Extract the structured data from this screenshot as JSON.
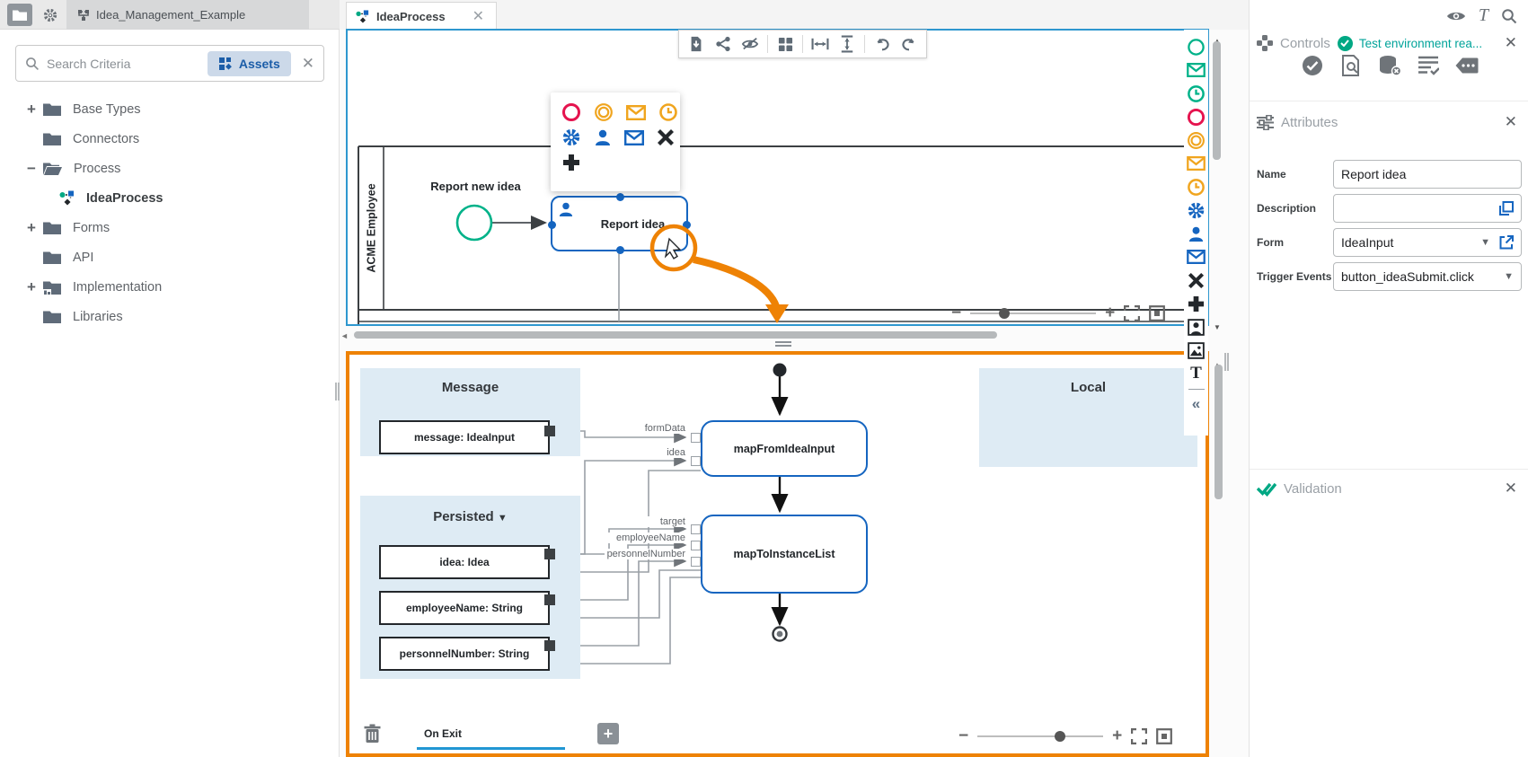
{
  "header": {
    "project_tab_label": "Idea_Management_Example"
  },
  "sidebar": {
    "search_placeholder": "Search Criteria",
    "assets_label": "Assets",
    "tree": [
      {
        "expander": "+",
        "label": "Base Types"
      },
      {
        "expander": "",
        "label": "Connectors"
      },
      {
        "expander": "−",
        "label": "Process"
      },
      {
        "expander": "",
        "label": "IdeaProcess"
      },
      {
        "expander": "+",
        "label": "Forms"
      },
      {
        "expander": "",
        "label": "API"
      },
      {
        "expander": "+",
        "label": "Implementation"
      },
      {
        "expander": "",
        "label": "Libraries"
      }
    ]
  },
  "editor": {
    "tab_label": "IdeaProcess",
    "bpmn": {
      "lane_label": "ACME Employee",
      "start_event_label": "Report new idea",
      "task_label": "Report idea"
    },
    "mapping": {
      "message_section": "Message",
      "persisted_section": "Persisted",
      "local_section": "Local",
      "message_box": "message: IdeaInput",
      "persisted_box_1": "idea: Idea",
      "persisted_box_2": "employeeName: String",
      "persisted_box_3": "personnelNumber: String",
      "node_1": "mapFromIdeaInput",
      "node_2": "mapToInstanceList",
      "label_formData": "formData",
      "label_idea": "idea",
      "label_target": "target",
      "label_employeeName": "employeeName",
      "label_personnelNumber": "personnelNumber",
      "footer_tab": "On Exit"
    }
  },
  "panel": {
    "controls": {
      "title": "Controls",
      "status": "Test environment rea..."
    },
    "attributes": {
      "title": "Attributes",
      "fields": [
        {
          "label": "Name",
          "value": "Report idea"
        },
        {
          "label": "Description",
          "value": ""
        },
        {
          "label": "Form",
          "value": "IdeaInput"
        },
        {
          "label": "Trigger Events",
          "value": "button_ideaSubmit.click"
        }
      ]
    },
    "validation": {
      "title": "Validation"
    }
  },
  "colors": {
    "accent_blue": "#1565c0",
    "canvas_selection_blue": "#2e97cf",
    "teal": "#00a884",
    "red": "#e5134e",
    "amber": "#f0a51f",
    "orange_highlight": "#ee8204",
    "section_bg": "#deebf4"
  }
}
